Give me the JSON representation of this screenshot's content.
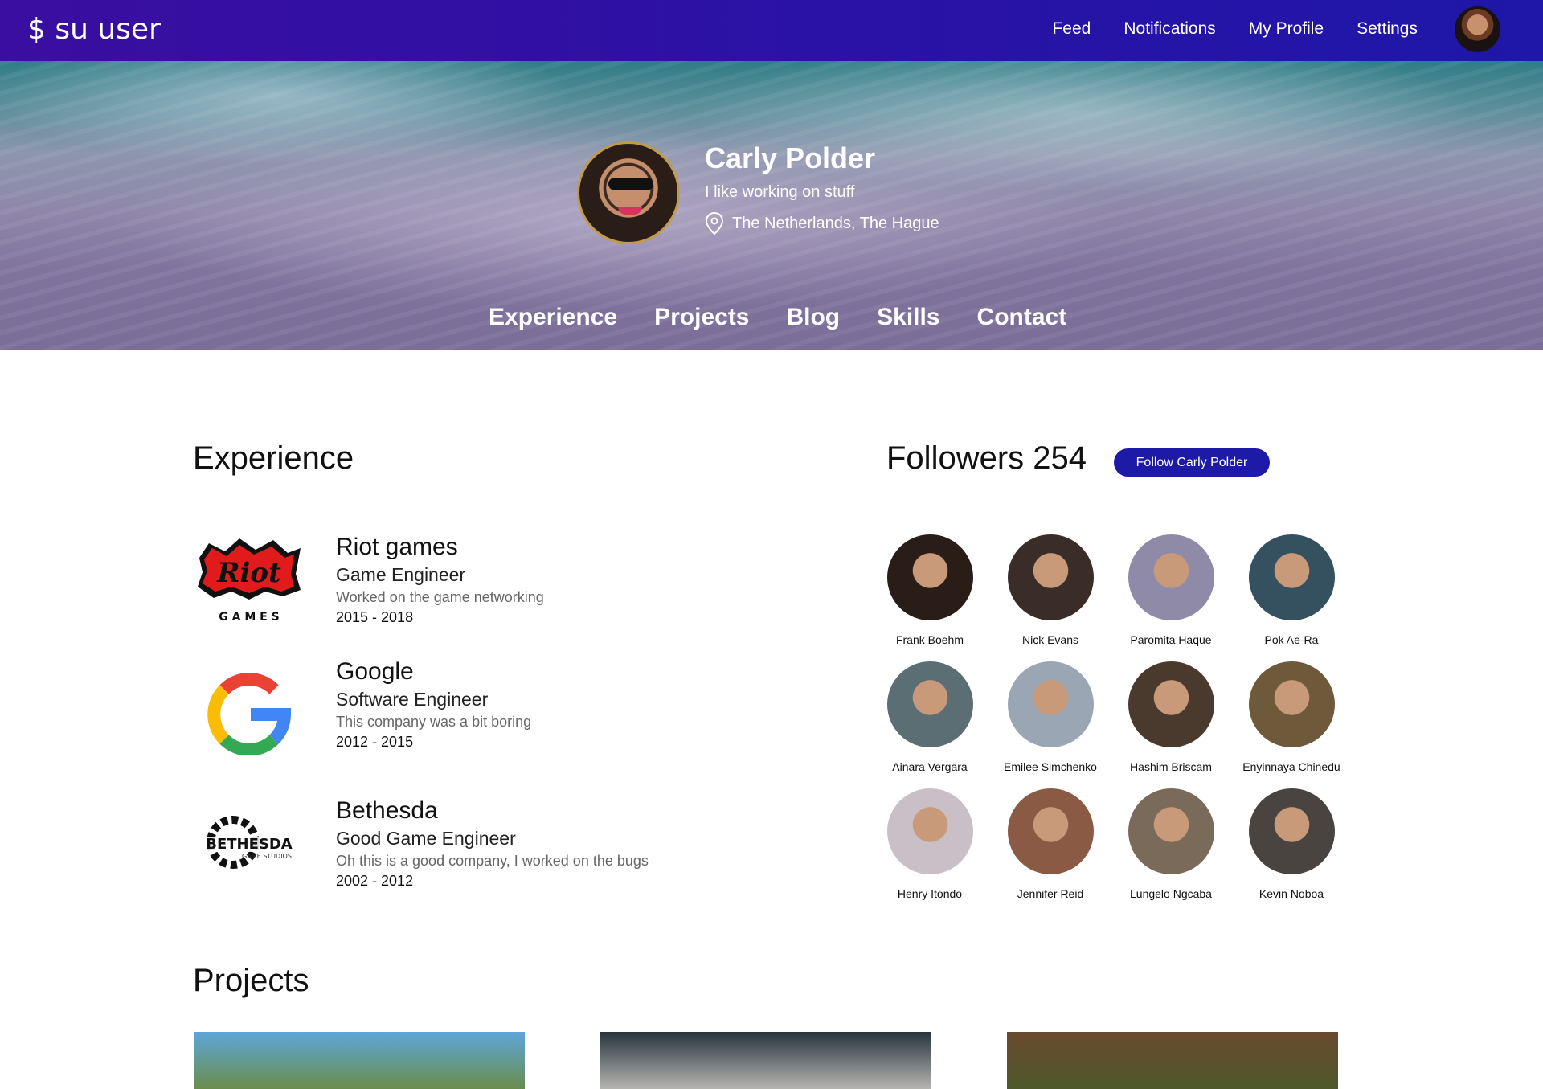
{
  "brand": "$ su user",
  "nav": {
    "items": [
      "Feed",
      "Notifications",
      "My Profile",
      "Settings"
    ]
  },
  "profile": {
    "name": "Carly Polder",
    "bio": "I like working on stuff",
    "location": "The Netherlands, The Hague"
  },
  "hero_tabs": [
    "Experience",
    "Projects",
    "Blog",
    "Skills",
    "Contact"
  ],
  "experience": {
    "title": "Experience",
    "items": [
      {
        "company": "Riot games",
        "role": "Game Engineer",
        "description": "Worked on the game networking",
        "years": "2015 - 2018",
        "logo_text": "Riot",
        "logo_sub": "G A M E S"
      },
      {
        "company": "Google",
        "role": "Software Engineer",
        "description": "This company was a bit boring",
        "years": "2012 - 2015",
        "logo_text": "G"
      },
      {
        "company": "Bethesda",
        "role": "Good Game Engineer",
        "description": "Oh this is a good company, I worked on the bugs",
        "years": "2002 - 2012",
        "logo_text": "BETHESDA",
        "logo_sub": "GAME STUDIOS"
      }
    ]
  },
  "followers": {
    "title": "Followers 254",
    "follow_button": "Follow Carly Polder",
    "people": [
      {
        "name": "Frank Boehm",
        "color": "#2a1c16"
      },
      {
        "name": "Nick Evans",
        "color": "#3a2c26"
      },
      {
        "name": "Paromita Haque",
        "color": "#8f8aa8"
      },
      {
        "name": "Pok Ae-Ra",
        "color": "#35505e"
      },
      {
        "name": "Ainara Vergara",
        "color": "#5a6e74"
      },
      {
        "name": "Emilee Simchenko",
        "color": "#9aa6b4"
      },
      {
        "name": "Hashim Briscam",
        "color": "#4a3a2e"
      },
      {
        "name": "Enyinnaya Chinedu",
        "color": "#6e5a3a"
      },
      {
        "name": "Henry Itondo",
        "color": "#c8c0c6"
      },
      {
        "name": "Jennifer Reid",
        "color": "#8a5a44"
      },
      {
        "name": "Lungelo Ngcaba",
        "color": "#7a6a5a"
      },
      {
        "name": "Kevin Noboa",
        "color": "#4a4440"
      }
    ]
  },
  "projects": {
    "title": "Projects",
    "thumbs": [
      {
        "color_top": "#5ea6d8",
        "color_bottom": "#6b8a3a"
      },
      {
        "color_top": "#27353e",
        "color_bottom": "#c8c4c0"
      },
      {
        "color_top": "#6a4a2e",
        "color_bottom": "#4a5a2a"
      }
    ]
  }
}
